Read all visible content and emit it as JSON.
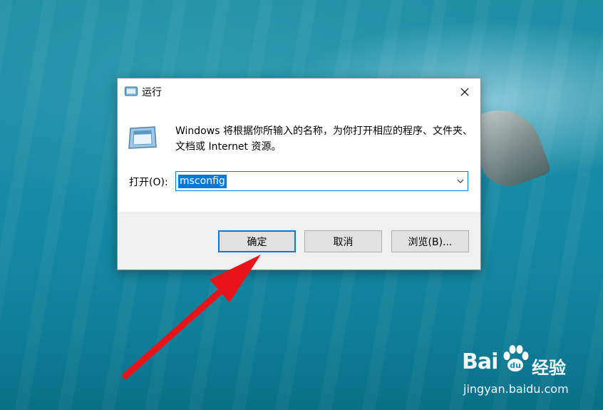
{
  "dialog": {
    "title": "运行",
    "description": "Windows 将根据你所输入的名称，为你打开相应的程序、文件夹、文档或 Internet 资源。",
    "open_label": "打开(O):",
    "open_value": "msconfig",
    "buttons": {
      "ok": "确定",
      "cancel": "取消",
      "browse": "浏览(B)..."
    }
  },
  "watermark": {
    "brand_left": "Bai",
    "brand_right": "经验",
    "url": "jingyan.baidu.com"
  },
  "colors": {
    "accent": "#0078d7",
    "arrow": "#e8141a"
  },
  "icons": [
    "run-app-icon",
    "close-icon",
    "chevron-down-icon",
    "red-arrow-annotation",
    "paw-logo-icon"
  ]
}
